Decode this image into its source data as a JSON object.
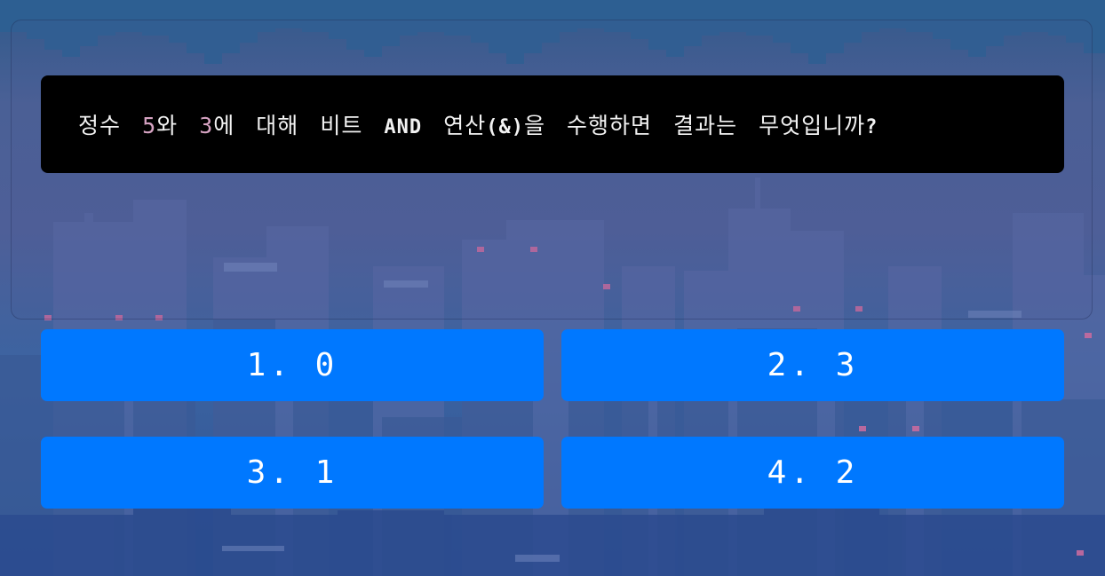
{
  "question": {
    "parts": [
      "정수 ",
      "5",
      "와 ",
      "3",
      "에 대해 비트 ",
      "AND",
      " 연산",
      "(&)",
      "을 수행하면 결과는 무엇입니까",
      "?"
    ]
  },
  "answers": [
    {
      "label": "1. 0"
    },
    {
      "label": "2. 3"
    },
    {
      "label": "3. 1"
    },
    {
      "label": "4. 2"
    }
  ],
  "colors": {
    "answer_button": "#0078ff",
    "question_bg": "#000000",
    "highlight_number": "#d6a3c2"
  }
}
